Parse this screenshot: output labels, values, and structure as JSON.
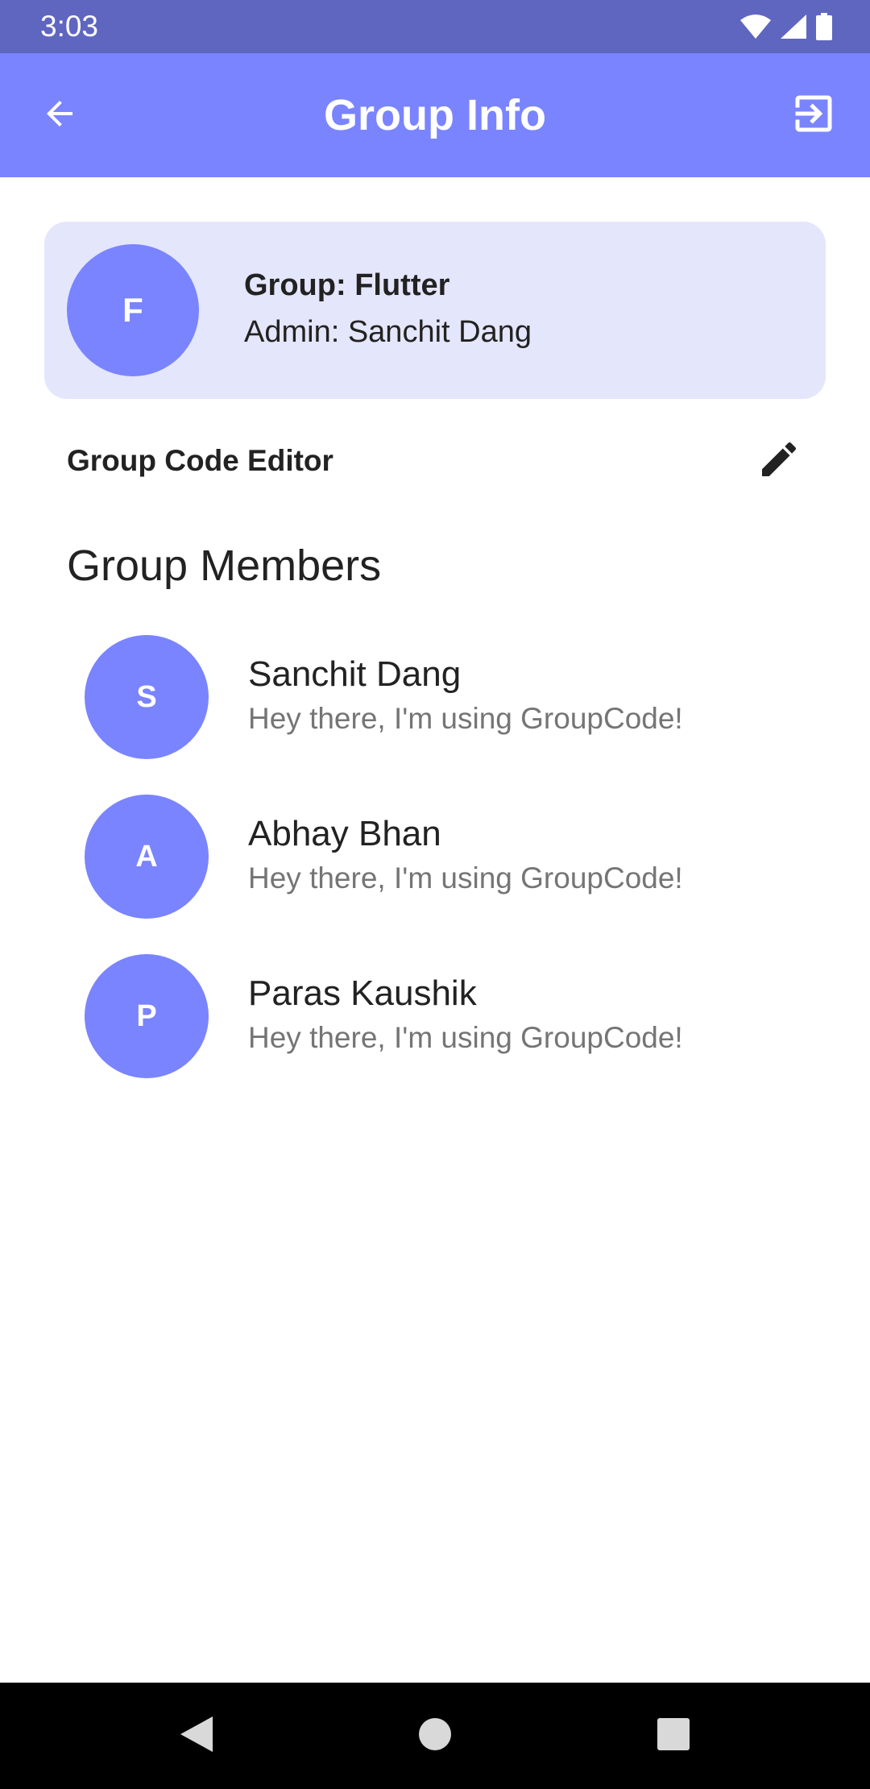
{
  "status_bar": {
    "time": "3:03",
    "icons": [
      "wifi-icon",
      "signal-icon",
      "battery-icon"
    ]
  },
  "app_bar": {
    "title": "Group Info",
    "back_icon": "arrow-back-icon",
    "exit_icon": "exit-to-app-icon"
  },
  "group": {
    "avatar_letter": "F",
    "name": "Group: Flutter",
    "admin": "Admin: Sanchit Dang"
  },
  "editor": {
    "label": "Group Code Editor",
    "icon": "pencil-icon"
  },
  "members": {
    "title": "Group Members",
    "items": [
      {
        "avatar_letter": "S",
        "name": "Sanchit Dang",
        "status": "Hey there, I'm using GroupCode!"
      },
      {
        "avatar_letter": "A",
        "name": "Abhay Bhan",
        "status": "Hey there, I'm using GroupCode!"
      },
      {
        "avatar_letter": "P",
        "name": "Paras Kaushik",
        "status": "Hey there, I'm using GroupCode!"
      }
    ]
  },
  "nav_bar": {
    "icons": [
      "nav-back-icon",
      "nav-home-icon",
      "nav-recents-icon"
    ]
  },
  "colors": {
    "status_bar": "#5f66c0",
    "app_bar": "#7a84ff",
    "card": "#e4e6fb",
    "avatar": "#7a84ff"
  }
}
